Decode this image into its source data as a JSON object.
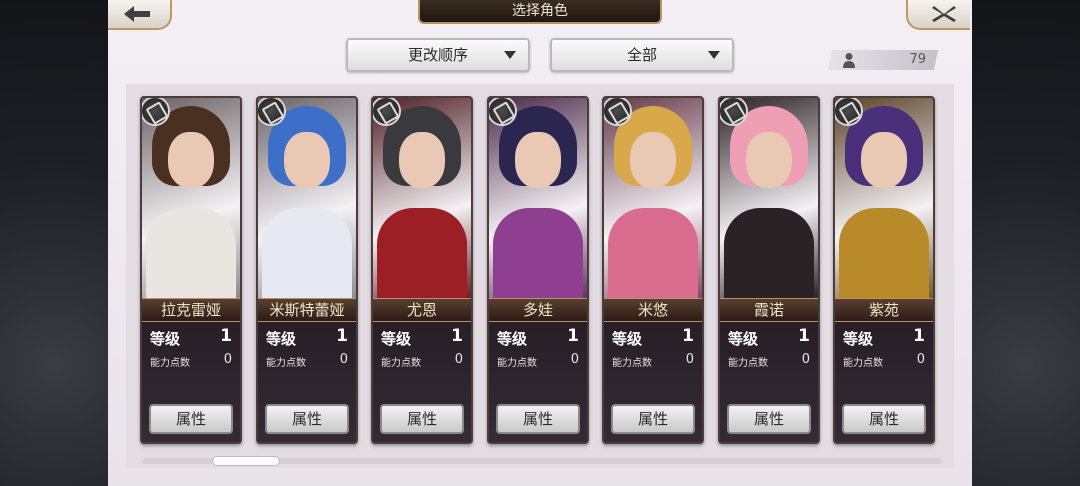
{
  "header": {
    "title": "选择角色"
  },
  "controls": {
    "sort_label": "更改顺序",
    "filter_label": "全部",
    "character_count": "79"
  },
  "cards": [
    {
      "name": "拉克雷娅",
      "level_label": "等级",
      "level": "1",
      "points_label": "能力点数",
      "points": "0",
      "button": "属性",
      "hair": "#4a3020",
      "outfit": "#e9e6e2"
    },
    {
      "name": "米斯特蕾娅",
      "level_label": "等级",
      "level": "1",
      "points_label": "能力点数",
      "points": "0",
      "button": "属性",
      "hair": "#3d6fc9",
      "outfit": "#e7e9f2"
    },
    {
      "name": "尤恩",
      "level_label": "等级",
      "level": "1",
      "points_label": "能力点数",
      "points": "0",
      "button": "属性",
      "hair": "#3a3a3e",
      "outfit": "#9b1f24"
    },
    {
      "name": "多娃",
      "level_label": "等级",
      "level": "1",
      "points_label": "能力点数",
      "points": "0",
      "button": "属性",
      "hair": "#2a2650",
      "outfit": "#8f3f8f"
    },
    {
      "name": "米悠",
      "level_label": "等级",
      "level": "1",
      "points_label": "能力点数",
      "points": "0",
      "button": "属性",
      "hair": "#d9a84a",
      "outfit": "#d96b8f"
    },
    {
      "name": "霞诺",
      "level_label": "等级",
      "level": "1",
      "points_label": "能力点数",
      "points": "0",
      "button": "属性",
      "hair": "#ef9fb4",
      "outfit": "#2a2225"
    },
    {
      "name": "紫苑",
      "level_label": "等级",
      "level": "1",
      "points_label": "能力点数",
      "points": "0",
      "button": "属性",
      "hair": "#4a2f7a",
      "outfit": "#b98a2a"
    }
  ]
}
